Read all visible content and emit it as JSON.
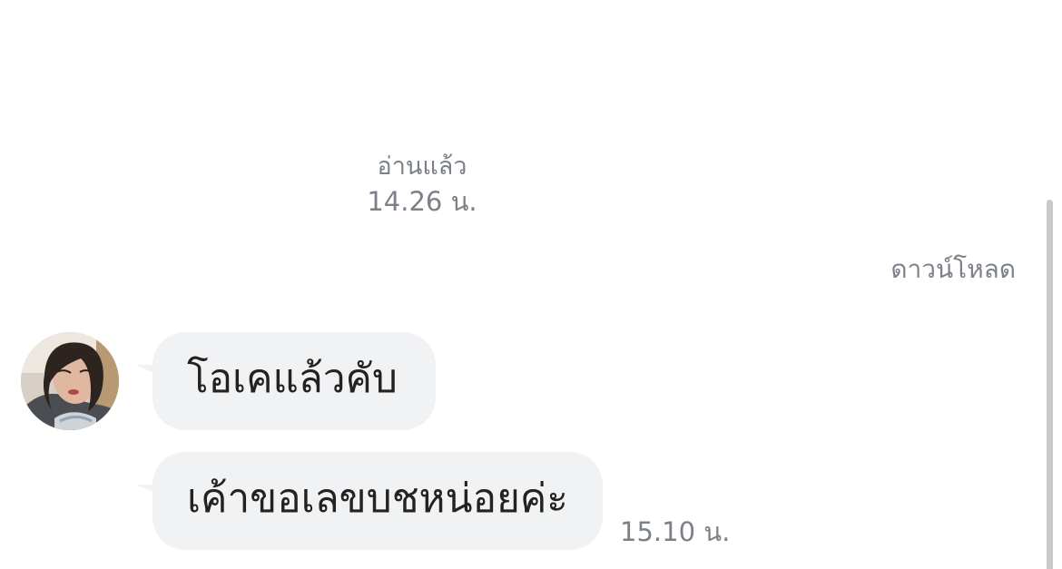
{
  "read_receipt": {
    "label": "อ่านแล้ว",
    "time": "14.26 น."
  },
  "download_label": "ดาวน์โหลด",
  "messages": [
    {
      "text": "โอเคแล้วคับ",
      "time": ""
    },
    {
      "text": "เค้าขอเลขบชหน่อยค่ะ",
      "time": "15.10 น."
    }
  ],
  "colors": {
    "background": "#ffffff",
    "bubble": "#f1f2f4",
    "meta_text": "#7b8089",
    "message_text": "#222222",
    "scrollbar": "#c9c9c9"
  },
  "icons": {
    "avatar": "contact-avatar"
  }
}
